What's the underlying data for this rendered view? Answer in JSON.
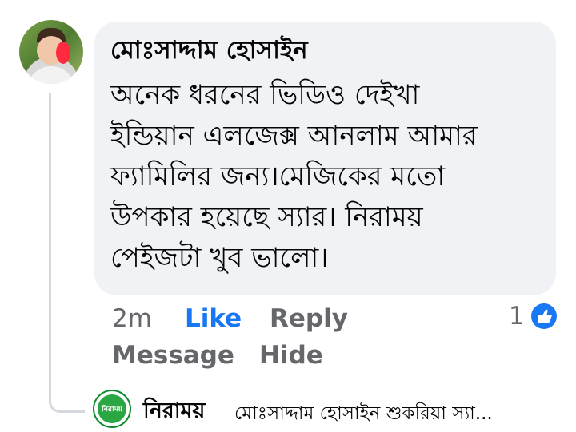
{
  "comment": {
    "author": "মোঃসাদ্দাম হোসাইন",
    "lines": [
      "অনেক ধরনের ভিডিও দেইখা",
      "ইন্ডিয়ান এলজেক্স আনলাম আমার",
      "ফ্যামিলির জন্য।মেজিকের মতো",
      "উপকার হয়েছে স্যার। নিরাময়",
      "পেইজটা খুব ভালো।"
    ],
    "time": "2m",
    "like_label": "Like",
    "reply_label": "Reply",
    "message_label": "Message",
    "hide_label": "Hide",
    "reaction_count": "1",
    "reaction_icon": "like-icon",
    "accent_color": "#1877f2"
  },
  "reply": {
    "avatar_text": "নিরাময়",
    "author": "নিরাময়",
    "preview": "মোঃসাদ্দাম হোসাইন শুকরিয়া স্যা..."
  }
}
